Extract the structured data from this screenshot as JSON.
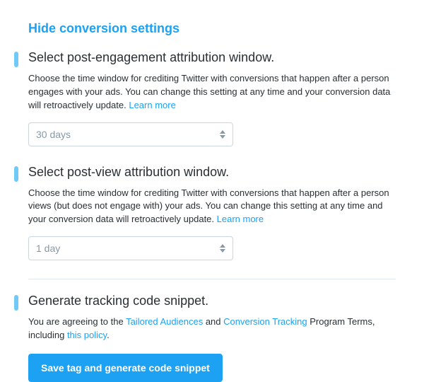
{
  "toggle_label": "Hide conversion settings",
  "sections": {
    "engagement": {
      "title": "Select post-engagement attribution window.",
      "desc_pre": "Choose the time window for crediting Twitter with conversions that happen after a person engages with your ads. You can change this setting at any time and your conversion data will retroactively update. ",
      "learn_more": "Learn more",
      "selected": "30 days"
    },
    "view": {
      "title": "Select post-view attribution window.",
      "desc_pre": "Choose the time window for crediting Twitter with conversions that happen after a person views (but does not engage with) your ads. You can change this setting at any time and your conversion data will retroactively update. ",
      "learn_more": "Learn more",
      "selected": "1 day"
    },
    "snippet": {
      "title": "Generate tracking code snippet.",
      "agree_pre": "You are agreeing to the ",
      "link1": "Tailored Audiences",
      "and": " and ",
      "link2": "Conversion Tracking",
      "agree_mid": " Program Terms, including ",
      "link3": "this policy",
      "agree_post": ".",
      "button_label": "Save tag and generate code snippet"
    }
  }
}
